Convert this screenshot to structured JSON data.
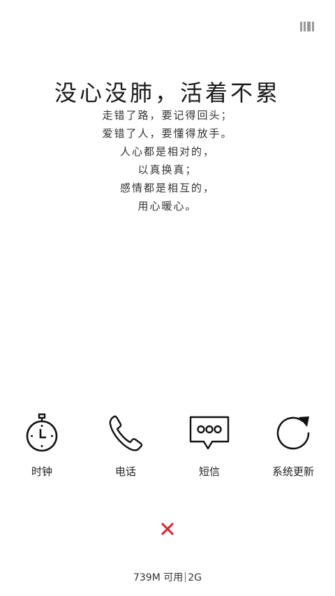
{
  "top_icon": "recent-apps-icon",
  "quote": {
    "title": "没心没肺，活着不累",
    "lines": [
      "走错了路，要记得回头；",
      "爱错了人，要懂得放手。",
      "人心都是相对的，",
      "以真换真；",
      "感情都是相互的，",
      "用心暖心。"
    ]
  },
  "apps": [
    {
      "label": "时钟",
      "icon": "stopwatch-icon"
    },
    {
      "label": "电话",
      "icon": "phone-icon"
    },
    {
      "label": "短信",
      "icon": "message-icon"
    },
    {
      "label": "系统更新",
      "icon": "refresh-icon"
    }
  ],
  "close_icon": "close-icon",
  "close_color": "#e0202a",
  "memory": {
    "available": "739M 可用",
    "total": "2G"
  }
}
